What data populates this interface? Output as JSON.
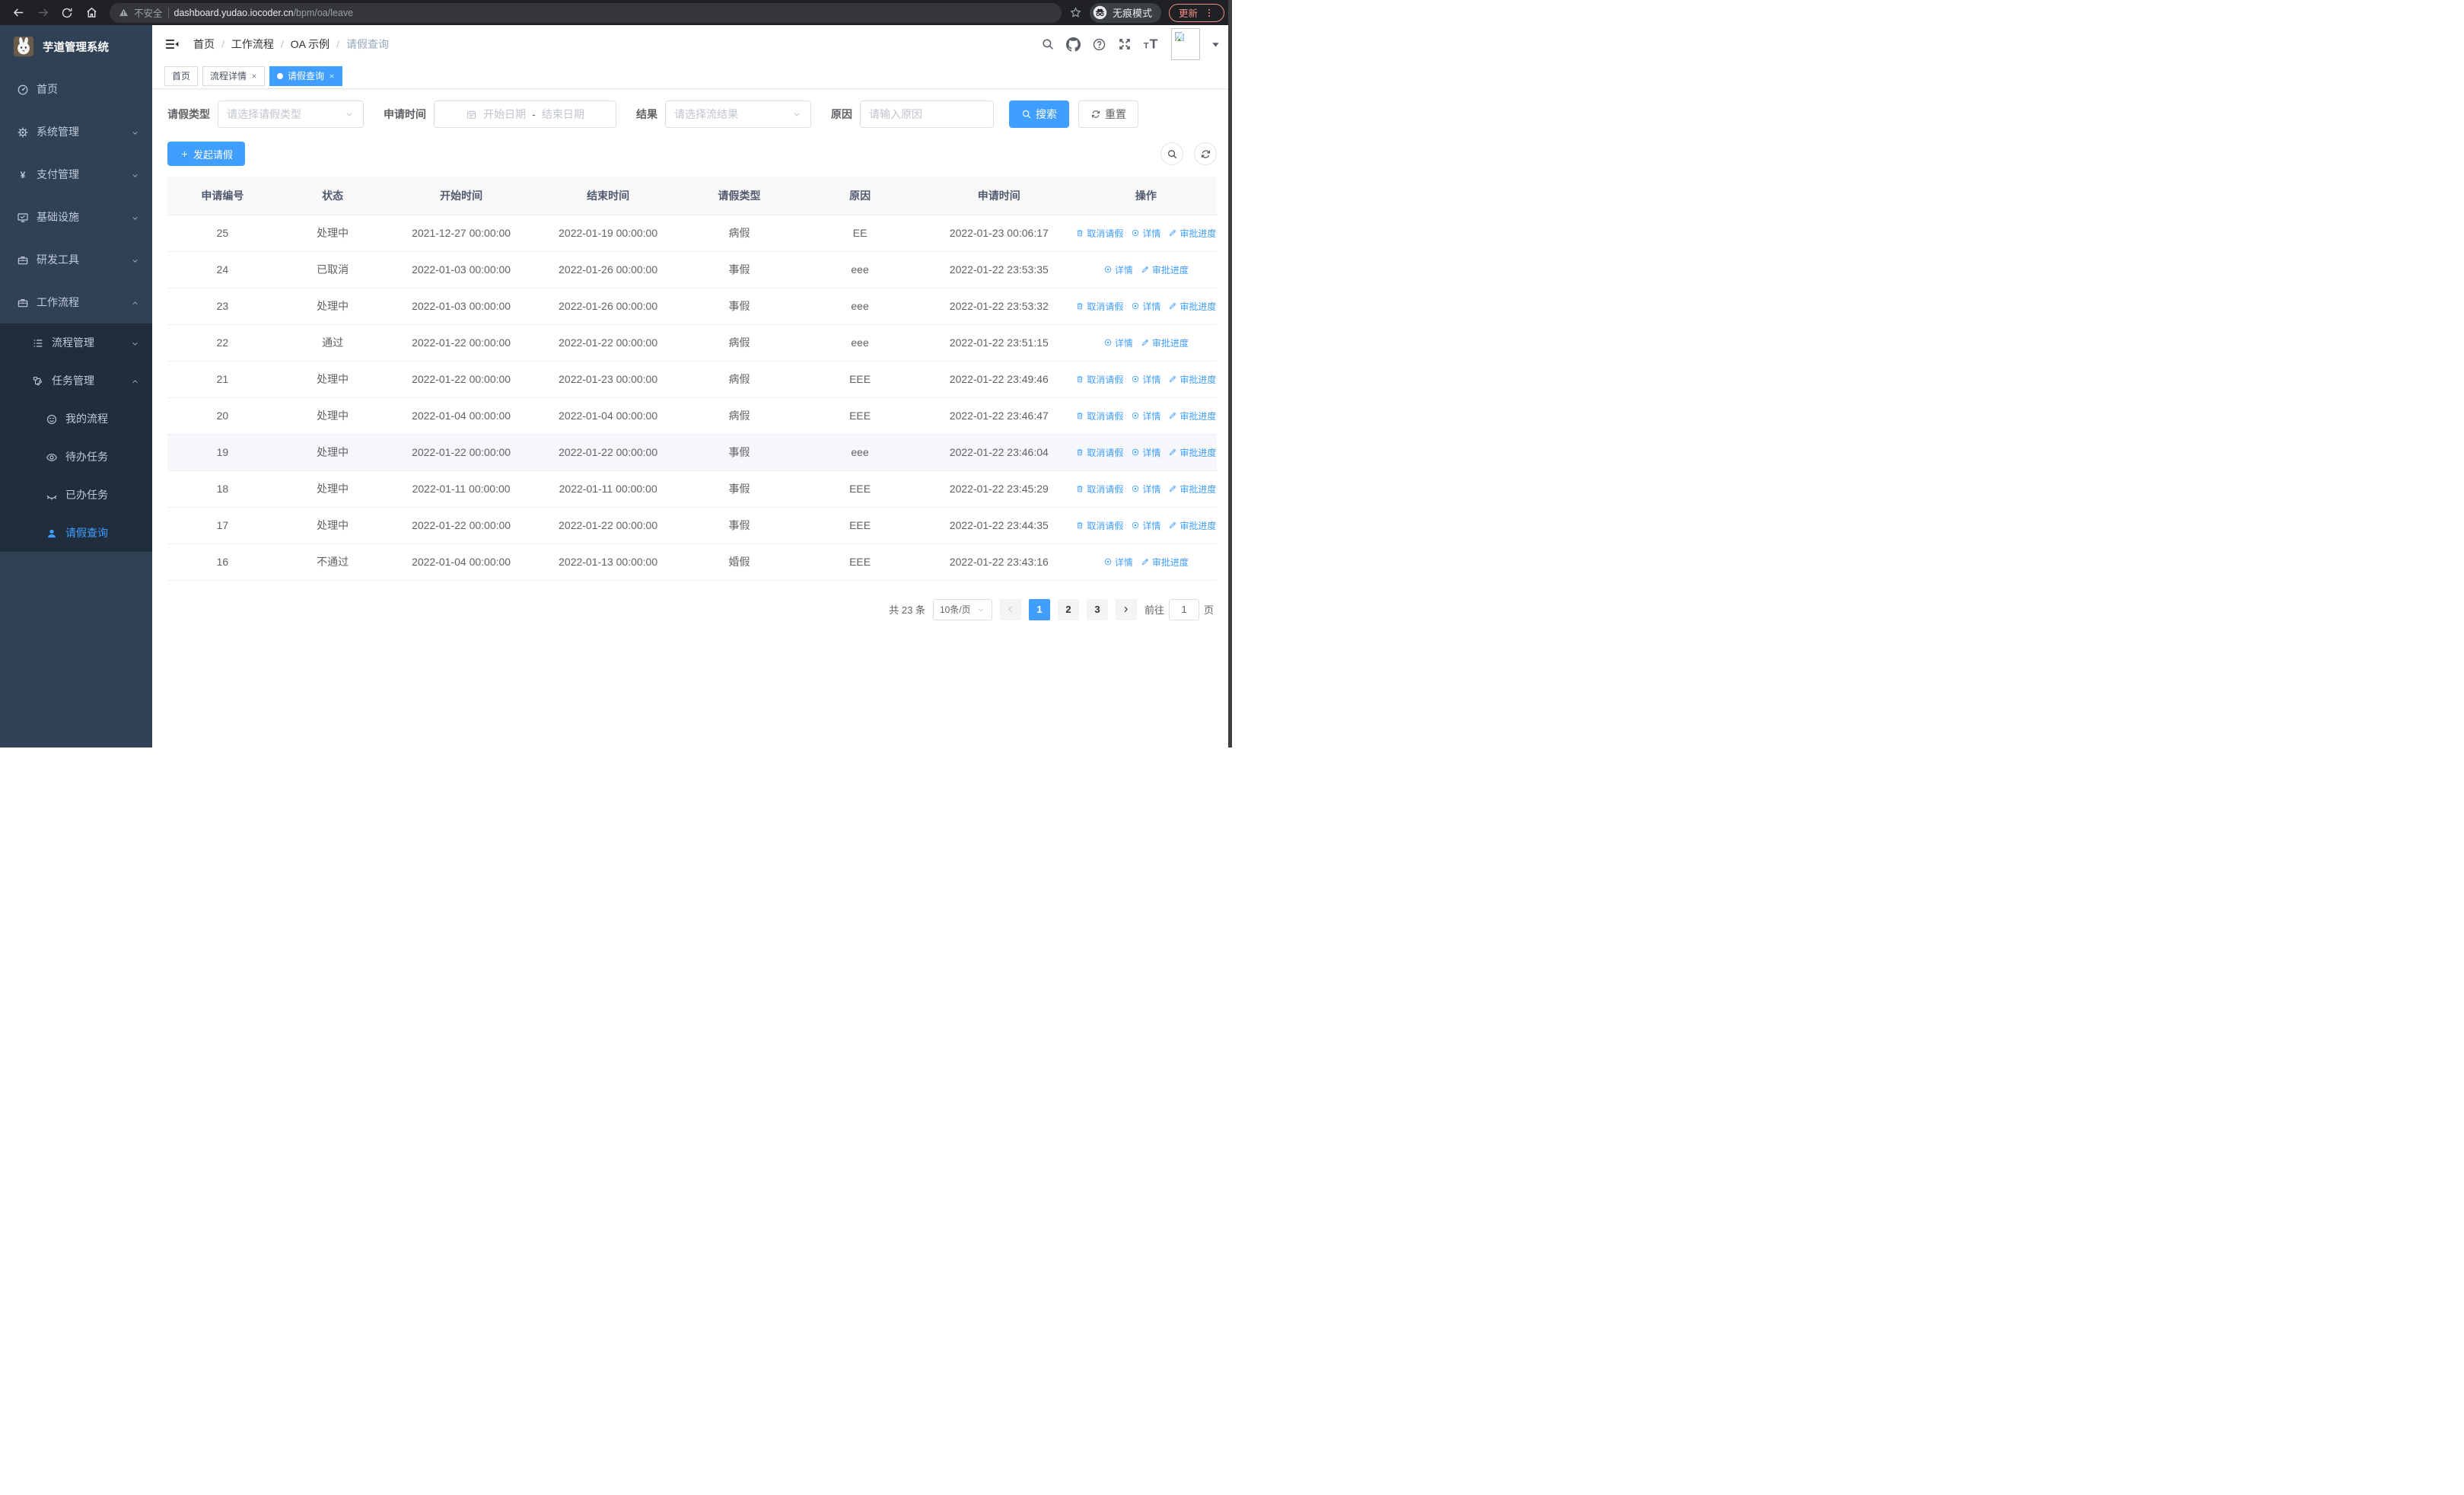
{
  "browser": {
    "security_label": "不安全",
    "url_domain": "dashboard.yudao.iocoder.cn",
    "url_path": "/bpm/oa/leave",
    "incognito_label": "无痕模式",
    "update_label": "更新"
  },
  "sidebar": {
    "title": "芋道管理系统",
    "items": [
      {
        "key": "home",
        "label": "首页",
        "icon": "i-gauge",
        "level": 1,
        "chevron": "",
        "dark": false,
        "active": false
      },
      {
        "key": "system-mgmt",
        "label": "系统管理",
        "icon": "i-gear",
        "level": 1,
        "chevron": "down",
        "dark": false,
        "active": false
      },
      {
        "key": "payment-mgmt",
        "label": "支付管理",
        "icon": "i-yen",
        "level": 1,
        "chevron": "down",
        "dark": false,
        "active": false
      },
      {
        "key": "infrastructure",
        "label": "基础设施",
        "icon": "i-monitor",
        "level": 1,
        "chevron": "down",
        "dark": false,
        "active": false
      },
      {
        "key": "dev-tools",
        "label": "研发工具",
        "icon": "i-briefcase",
        "level": 1,
        "chevron": "down",
        "dark": false,
        "active": false
      },
      {
        "key": "workflow",
        "label": "工作流程",
        "icon": "i-briefcase",
        "level": 1,
        "chevron": "up",
        "dark": false,
        "active": false
      },
      {
        "key": "process-mgmt",
        "label": "流程管理",
        "icon": "i-listtree",
        "level": 2,
        "chevron": "down",
        "dark": true,
        "active": false
      },
      {
        "key": "task-mgmt",
        "label": "任务管理",
        "icon": "i-org",
        "level": 2,
        "chevron": "up",
        "dark": true,
        "active": false
      },
      {
        "key": "my-process",
        "label": "我的流程",
        "icon": "i-face",
        "level": 3,
        "chevron": "",
        "dark": true,
        "active": false
      },
      {
        "key": "todo-tasks",
        "label": "待办任务",
        "icon": "i-eye",
        "level": 3,
        "chevron": "",
        "dark": true,
        "active": false
      },
      {
        "key": "done-tasks",
        "label": "已办任务",
        "icon": "i-eyeclosed",
        "level": 3,
        "chevron": "",
        "dark": true,
        "active": false
      },
      {
        "key": "leave-query",
        "label": "请假查询",
        "icon": "i-user",
        "level": 3,
        "chevron": "",
        "dark": true,
        "active": true
      }
    ]
  },
  "header": {
    "breadcrumb": [
      "首页",
      "工作流程",
      "OA 示例",
      "请假查询"
    ]
  },
  "tabs": [
    {
      "key": "home",
      "label": "首页",
      "closable": false,
      "active": false
    },
    {
      "key": "process-detail",
      "label": "流程详情",
      "closable": true,
      "active": false
    },
    {
      "key": "leave-query",
      "label": "请假查询",
      "closable": true,
      "active": true
    }
  ],
  "filters": {
    "type_label": "请假类型",
    "type_placeholder": "请选择请假类型",
    "time_label": "申请时间",
    "start_placeholder": "开始日期",
    "range_separator": "-",
    "end_placeholder": "结束日期",
    "result_label": "结果",
    "result_placeholder": "请选择流结果",
    "reason_label": "原因",
    "reason_placeholder": "请输入原因",
    "search_label": "搜索",
    "reset_label": "重置"
  },
  "toolbar": {
    "create_label": "发起请假"
  },
  "table": {
    "columns": [
      "申请编号",
      "状态",
      "开始时间",
      "结束时间",
      "请假类型",
      "原因",
      "申请时间",
      "操作"
    ],
    "action_labels": {
      "cancel": "取消请假",
      "detail": "详情",
      "progress": "审批进度"
    },
    "rows": [
      {
        "id": "25",
        "status": "处理中",
        "start": "2021-12-27 00:00:00",
        "end": "2022-01-19 00:00:00",
        "type": "病假",
        "reason": "EE",
        "applied": "2022-01-23 00:06:17",
        "actions": [
          "cancel",
          "detail",
          "progress"
        ],
        "highlight": false
      },
      {
        "id": "24",
        "status": "已取消",
        "start": "2022-01-03 00:00:00",
        "end": "2022-01-26 00:00:00",
        "type": "事假",
        "reason": "eee",
        "applied": "2022-01-22 23:53:35",
        "actions": [
          "detail",
          "progress"
        ],
        "highlight": false
      },
      {
        "id": "23",
        "status": "处理中",
        "start": "2022-01-03 00:00:00",
        "end": "2022-01-26 00:00:00",
        "type": "事假",
        "reason": "eee",
        "applied": "2022-01-22 23:53:32",
        "actions": [
          "cancel",
          "detail",
          "progress"
        ],
        "highlight": false
      },
      {
        "id": "22",
        "status": "通过",
        "start": "2022-01-22 00:00:00",
        "end": "2022-01-22 00:00:00",
        "type": "病假",
        "reason": "eee",
        "applied": "2022-01-22 23:51:15",
        "actions": [
          "detail",
          "progress"
        ],
        "highlight": false
      },
      {
        "id": "21",
        "status": "处理中",
        "start": "2022-01-22 00:00:00",
        "end": "2022-01-23 00:00:00",
        "type": "病假",
        "reason": "EEE",
        "applied": "2022-01-22 23:49:46",
        "actions": [
          "cancel",
          "detail",
          "progress"
        ],
        "highlight": false
      },
      {
        "id": "20",
        "status": "处理中",
        "start": "2022-01-04 00:00:00",
        "end": "2022-01-04 00:00:00",
        "type": "病假",
        "reason": "EEE",
        "applied": "2022-01-22 23:46:47",
        "actions": [
          "cancel",
          "detail",
          "progress"
        ],
        "highlight": false
      },
      {
        "id": "19",
        "status": "处理中",
        "start": "2022-01-22 00:00:00",
        "end": "2022-01-22 00:00:00",
        "type": "事假",
        "reason": "eee",
        "applied": "2022-01-22 23:46:04",
        "actions": [
          "cancel",
          "detail",
          "progress"
        ],
        "highlight": true
      },
      {
        "id": "18",
        "status": "处理中",
        "start": "2022-01-11 00:00:00",
        "end": "2022-01-11 00:00:00",
        "type": "事假",
        "reason": "EEE",
        "applied": "2022-01-22 23:45:29",
        "actions": [
          "cancel",
          "detail",
          "progress"
        ],
        "highlight": false
      },
      {
        "id": "17",
        "status": "处理中",
        "start": "2022-01-22 00:00:00",
        "end": "2022-01-22 00:00:00",
        "type": "事假",
        "reason": "EEE",
        "applied": "2022-01-22 23:44:35",
        "actions": [
          "cancel",
          "detail",
          "progress"
        ],
        "highlight": false
      },
      {
        "id": "16",
        "status": "不通过",
        "start": "2022-01-04 00:00:00",
        "end": "2022-01-13 00:00:00",
        "type": "婚假",
        "reason": "EEE",
        "applied": "2022-01-22 23:43:16",
        "actions": [
          "detail",
          "progress"
        ],
        "highlight": false
      }
    ]
  },
  "pagination": {
    "total_label": "共 23 条",
    "page_size": "10条/页",
    "pages": [
      "1",
      "2",
      "3"
    ],
    "active_page": "1",
    "goto_label": "前往",
    "goto_value": "1",
    "goto_suffix": "页"
  },
  "colors": {
    "accent": "#409eff",
    "sidebar_bg": "#304156",
    "submenu_bg": "#1f2d3d"
  }
}
